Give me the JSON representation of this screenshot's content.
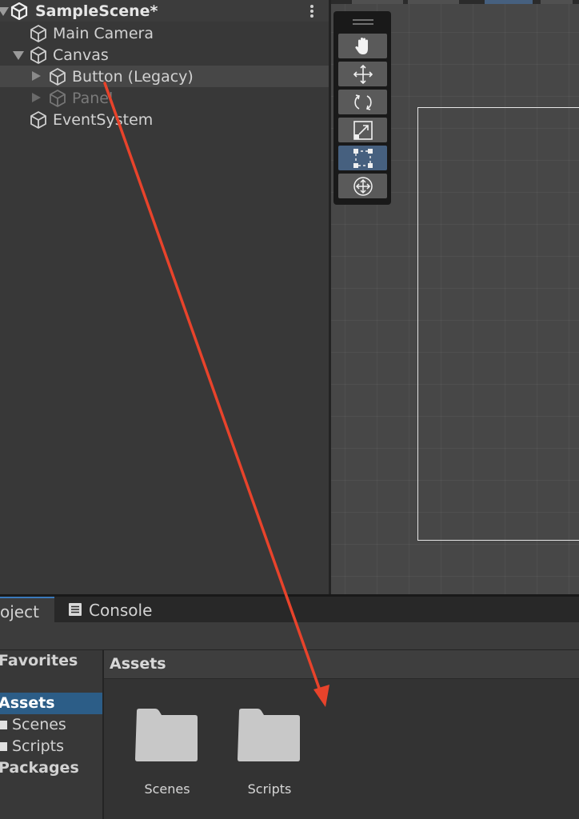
{
  "hierarchy": {
    "scene_name": "SampleScene*",
    "items": [
      {
        "label": "Main Camera"
      },
      {
        "label": "Canvas"
      },
      {
        "label": "Button (Legacy)"
      },
      {
        "label": "Panel"
      },
      {
        "label": "EventSystem"
      }
    ]
  },
  "tools": [
    {
      "name": "hand-tool",
      "active": false
    },
    {
      "name": "move-tool",
      "active": false
    },
    {
      "name": "rotate-tool",
      "active": false
    },
    {
      "name": "scale-tool",
      "active": false
    },
    {
      "name": "rect-tool",
      "active": true
    },
    {
      "name": "transform-tool",
      "active": false
    }
  ],
  "project": {
    "tabs": [
      {
        "label": "oject"
      },
      {
        "label": "Console"
      }
    ],
    "left_tree": {
      "favorites": "Favorites",
      "assets": "Assets",
      "scenes": "Scenes",
      "scripts": "Scripts",
      "packages": "Packages"
    },
    "breadcrumb": "Assets",
    "folders": [
      {
        "label": "Scenes"
      },
      {
        "label": "Scripts"
      }
    ]
  },
  "colors": {
    "selection": "#2c5d87",
    "active_tool": "#46607f",
    "annotation_arrow": "#e8432b"
  }
}
